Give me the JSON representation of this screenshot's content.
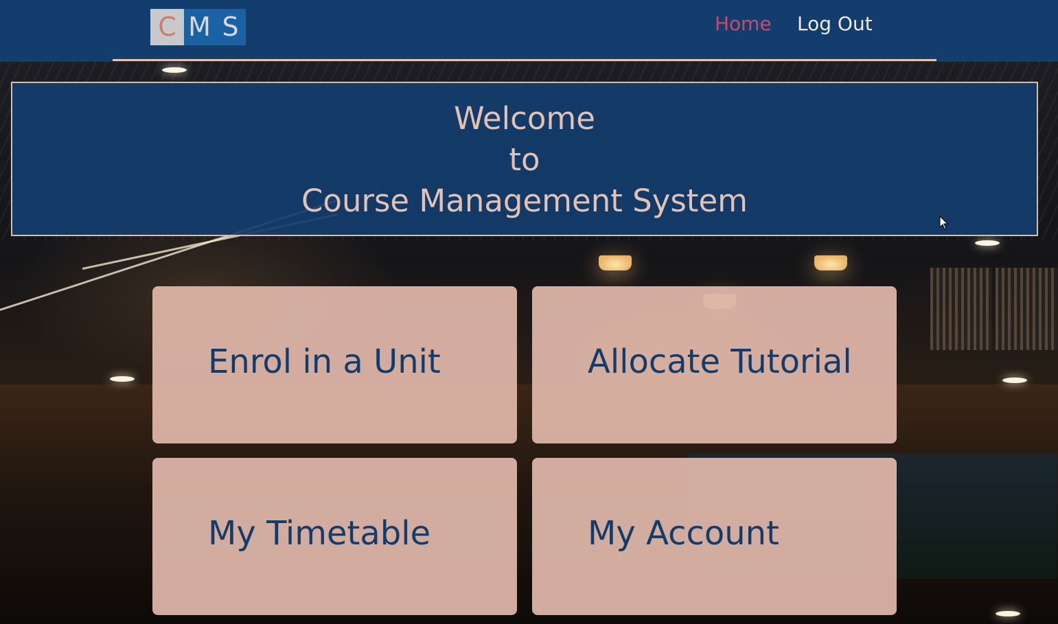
{
  "logo": {
    "letters": [
      "C",
      "M",
      "S"
    ]
  },
  "nav": {
    "home_label": "Home",
    "logout_label": "Log Out"
  },
  "welcome": {
    "lines": [
      "Welcome",
      "to",
      "Course Management System"
    ]
  },
  "tiles": [
    {
      "label": "Enrol in a Unit"
    },
    {
      "label": "Allocate Tutorial"
    },
    {
      "label": "My Timetable"
    },
    {
      "label": "My Account"
    }
  ],
  "colors": {
    "topbar": "#133d6d",
    "nav_active": "#c94a6e",
    "nav_text": "#f2eae7",
    "banner_text": "#e3c2b6",
    "tile_bg": "#deb6a8",
    "tile_text": "#143c6a"
  }
}
